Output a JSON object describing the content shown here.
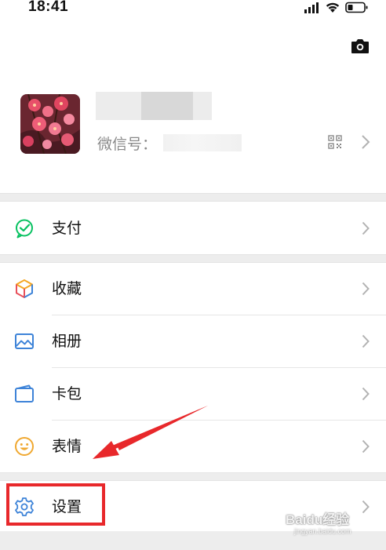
{
  "status_bar": {
    "time": "18:41",
    "icons": [
      "signal-icon",
      "wifi-icon",
      "battery-icon"
    ]
  },
  "header": {
    "camera_icon": "camera-icon"
  },
  "profile": {
    "wechat_id_label": "微信号：",
    "qr_icon": "qr-code-icon"
  },
  "menu_groups": [
    {
      "items": [
        {
          "label": "支付",
          "icon": "pay-icon",
          "color": "#07c160"
        }
      ]
    },
    {
      "items": [
        {
          "label": "收藏",
          "icon": "favorites-icon",
          "color": "#f29b38"
        },
        {
          "label": "相册",
          "icon": "album-icon",
          "color": "#3d83d8"
        },
        {
          "label": "卡包",
          "icon": "card-wallet-icon",
          "color": "#3d83d8"
        },
        {
          "label": "表情",
          "icon": "sticker-icon",
          "color": "#f0a830"
        }
      ]
    },
    {
      "items": [
        {
          "label": "设置",
          "icon": "settings-icon",
          "color": "#3d83d8"
        }
      ]
    }
  ],
  "annotation": {
    "highlight_color": "#e8282b"
  },
  "watermark": {
    "text": "Baidu经验",
    "sub": "jingyan.baidu.com"
  }
}
